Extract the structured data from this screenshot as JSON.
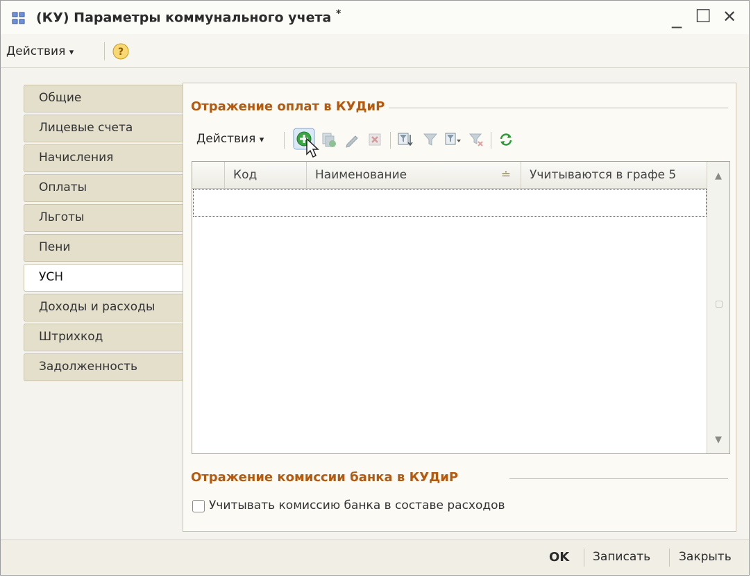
{
  "window": {
    "title": "(КУ) Параметры коммунального учета",
    "modified_mark": "*",
    "minimize": "_",
    "maximize": "☐",
    "close": "✕"
  },
  "toolbar": {
    "actions_label": "Действия",
    "actions_arrow": "▾"
  },
  "tabs": [
    "Общие",
    "Лицевые счета",
    "Начисления",
    "Оплаты",
    "Льготы",
    "Пени",
    "УСН",
    "Доходы и расходы",
    "Штрихкод",
    "Задолженность"
  ],
  "active_tab": "УСН",
  "panel": {
    "group1_title": "Отражение оплат в КУДиР",
    "inner_toolbar": {
      "actions_label": "Действия",
      "actions_arrow": "▾",
      "icons": [
        "add-icon",
        "copy-icon",
        "edit-icon",
        "delete-icon",
        "filter-by-value-icon",
        "filter-icon",
        "filter-dropdown-icon",
        "clear-filter-icon",
        "refresh-icon"
      ]
    },
    "table": {
      "columns": [
        "",
        "Код",
        "Наименование",
        "Учитываются в графе 5"
      ],
      "sort_indicator": "≐",
      "rows": []
    },
    "group2_title": "Отражение комиссии банка в КУДиР",
    "checkbox_label": "Учитывать комиссию банка в составе расходов",
    "checkbox_checked": false
  },
  "bottom_bar": {
    "ok": "OK",
    "save": "Записать",
    "close": "Закрыть"
  }
}
